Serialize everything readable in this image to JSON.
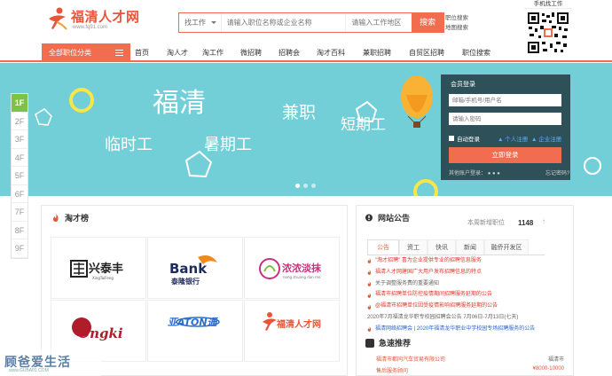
{
  "header": {
    "logo_text": "福清人才网",
    "logo_url": "www.fq91.com",
    "search": {
      "type_label": "找工作",
      "keyword_placeholder": "请输入职位名称或企业名称",
      "area_placeholder": "请输入工作地区",
      "button": "搜索"
    },
    "links": [
      "职位搜索",
      "地图搜索"
    ],
    "qr_caption": "手机找工作"
  },
  "nav": {
    "category": "全部职位分类",
    "items": [
      "首页",
      "淘人才",
      "淘工作",
      "微招聘",
      "招聘会",
      "淘才百科",
      "兼职招聘",
      "自贸区招聘",
      "职位搜索"
    ]
  },
  "banner": {
    "texts": [
      "福清",
      "临时工",
      "暑期工",
      "兼职",
      "短期工"
    ]
  },
  "floors": [
    "1F",
    "2F",
    "3F",
    "4F",
    "5F",
    "6F",
    "7F",
    "8F",
    "9F"
  ],
  "login": {
    "title": "会员登录",
    "username_placeholder": "邮箱/手机号/用户名",
    "password_placeholder": "请输入密码",
    "remember": "自动登录",
    "personal_register": "个人注册",
    "company_register": "企业注册",
    "button": "立即登录",
    "other": "其他账户登录：",
    "forgot": "忘记密码?"
  },
  "talent": {
    "title": "淘才榜",
    "logos": [
      {
        "main": "兴泰丰",
        "sub": "XingTaiFeng"
      },
      {
        "main": "Bank",
        "sub": "泰隆银行"
      },
      {
        "main": "浓浓淡抹",
        "sub": "nong zhuang dan mo"
      },
      {
        "main": "Ongki",
        "sub": ""
      },
      {
        "main": "亚ATON通",
        "sub": ""
      },
      {
        "main": "福清人才网",
        "sub": ""
      }
    ]
  },
  "notice": {
    "title": "网站公告",
    "week_label": "本周新增职位",
    "week_count": "1148",
    "tabs": [
      "公告",
      "资工",
      "快讯",
      "新闻",
      "融侨开发区"
    ],
    "items": [
      {
        "text": "\"淘才招聘\" 喜为企业提供专业的招聘信息服务",
        "style": "red"
      },
      {
        "text": "福清人才网建国广大用户发布招聘信息的特点",
        "style": "red"
      },
      {
        "text": "关于调整服务费的重要通知",
        "style": "gray"
      },
      {
        "text": "福清市招聘单位防控疫情期间招聘服务延期的公告",
        "style": "red"
      },
      {
        "text": "@福清市招聘单位因受疫情影响招聘服务延期的公告",
        "style": "red"
      },
      {
        "text": "2020年7月福清龙华职专校园招聘会公告 7月06日-7月13日(七天)",
        "style": "gray"
      },
      {
        "text": "福清网络招聘会 | 2020年福清龙华职业中学校园专场招聘服务的公告",
        "style": "blue"
      }
    ],
    "urgent_title": "急速推荐",
    "urgent": [
      {
        "company": "福清市都同汽车贸易有限公司",
        "right": "福清市"
      },
      {
        "company": "售后服务顾问",
        "right": "¥8000-10000"
      }
    ]
  },
  "watermark": {
    "text": "顾爸爱生活",
    "url": "www.GUBA01.COM"
  },
  "colors": {
    "accent": "#f26c4f",
    "banner": "#72cfd8",
    "floor_active": "#7dc242"
  }
}
